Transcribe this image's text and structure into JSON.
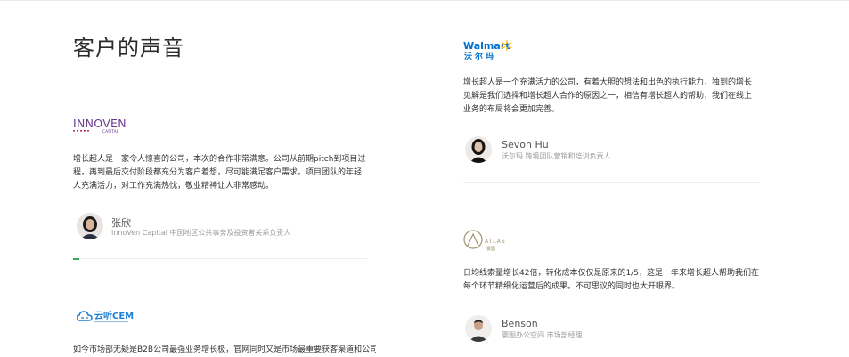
{
  "page": {
    "title": "客户的声音"
  },
  "colors": {
    "walmart_blue": "#0071ce",
    "walmart_spark": "#ffc220",
    "innoven_purple": "#6b3c8c",
    "innoven_pink": "#c0306f",
    "yunting_blue": "#1f7fd6",
    "atlas_gold": "#a39274",
    "progress_green": "#3ba55c"
  },
  "testimonials": [
    {
      "logo": {
        "icon": "innoven-capital-logo",
        "wordmark": "INNOVEN",
        "subline": "CAPITAL"
      },
      "quote": "增长超人是一家令人惊喜的公司，本次的合作非常满意。公司从前期pitch到项目过程，再到最后交付阶段都充分为客户着想，尽可能满足客户需求。项目团队的年轻人充满活力，对工作充满热忱，敬业精神让人非常感动。",
      "name": "张欣",
      "role": "InnoVen Capital 中国地区公共事务及投资者关系负责人",
      "avatar": "avatar-woman-icon"
    },
    {
      "logo": {
        "icon": "yunting-cem-logo",
        "wordmark": "云听CEM"
      },
      "quote": "如今市场部无疑是B2B公司最强业务增长极，官网同时又是市场最重要获客渠道和公司"
    },
    {
      "logo": {
        "icon": "walmart-logo",
        "wordmark": "Walmart",
        "subline": "沃尔玛"
      },
      "quote": "增长超人是一个充满活力的公司，有着大胆的想法和出色的执行能力，独到的增长见解是我们选择和增长超人合作的原因之一，相信有增长超人的帮助，我们在线上业务的布局将会更加完善。",
      "name": "Sevon Hu",
      "role": "沃尔玛 跨境团队营销和培训负责人",
      "avatar": "avatar-woman-icon"
    },
    {
      "logo": {
        "icon": "atlas-logo",
        "wordmark": "ATLAS",
        "subline": "寰图"
      },
      "quote": "日均线索量增长42倍，转化成本仅仅是原来的1/5，这是一年来增长超人帮助我们在每个环节精细化运营后的成果。不可思议的同时也大开眼界。",
      "name": "Benson",
      "role": "寰图办公空间 市场部经理",
      "avatar": "avatar-man-icon"
    }
  ],
  "carousel": {
    "progress": 0.02
  }
}
